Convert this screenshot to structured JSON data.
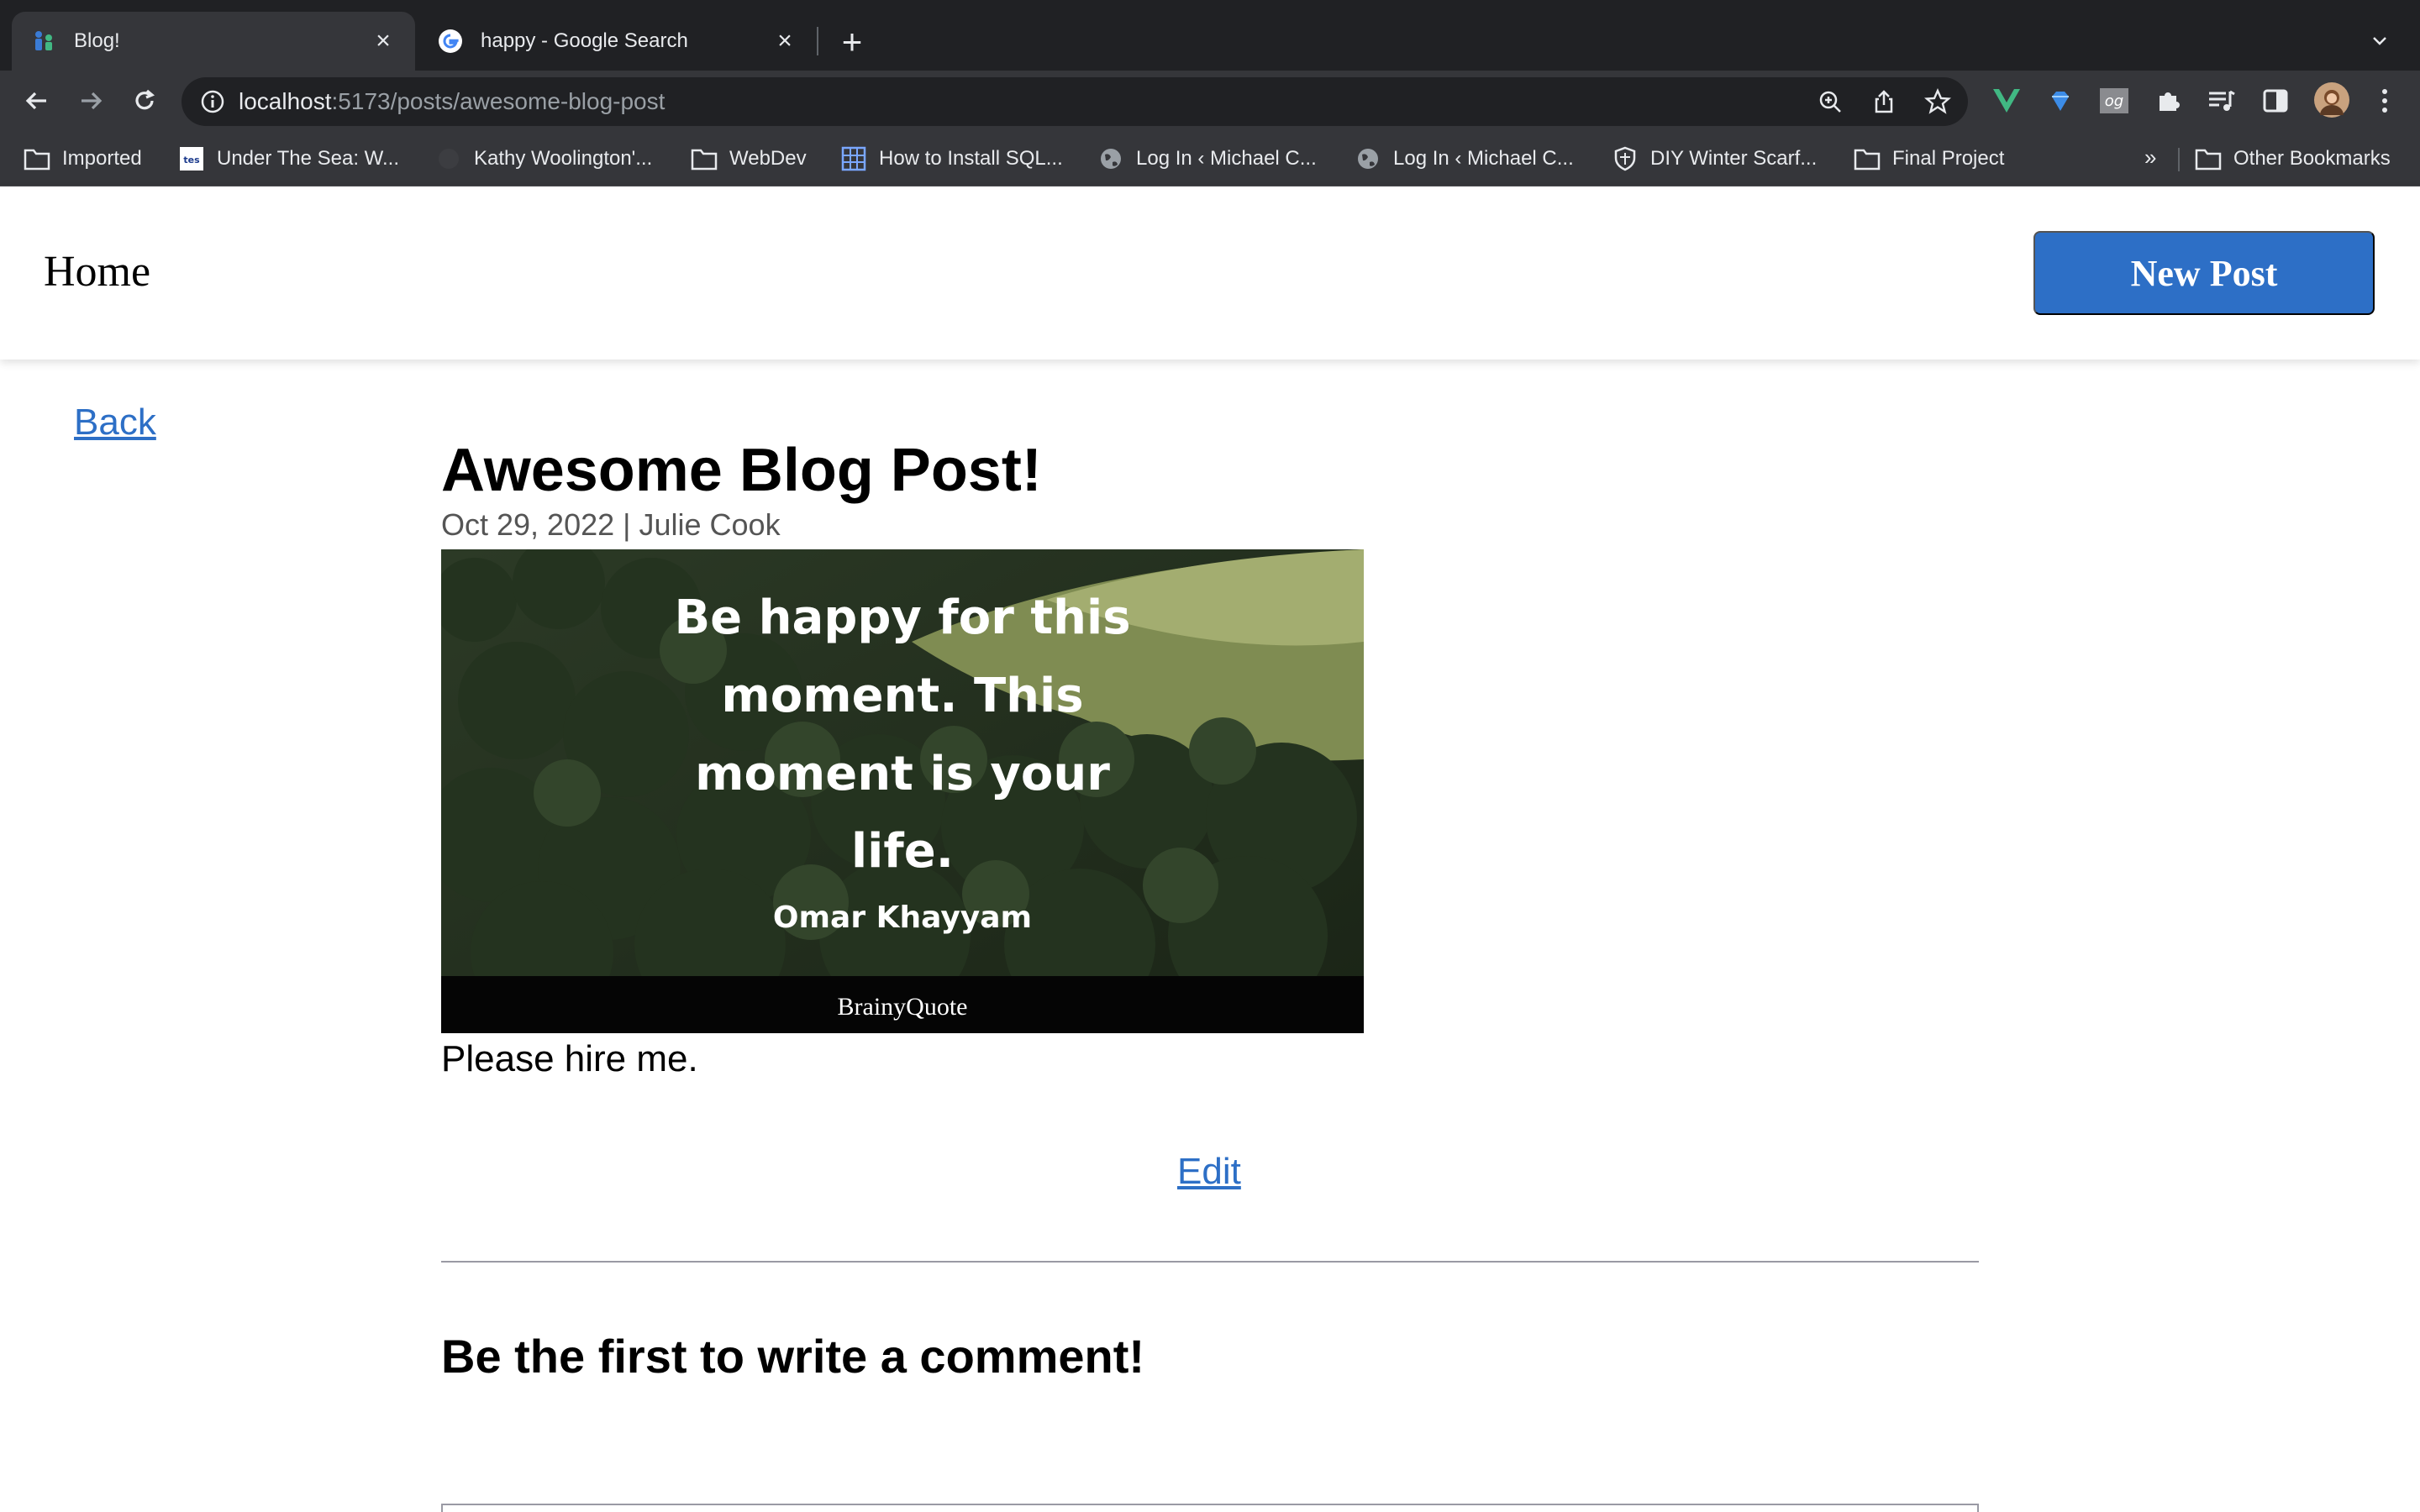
{
  "browser": {
    "tabs": [
      {
        "title": "Blog!",
        "icon": "blog-favicon",
        "active": true
      },
      {
        "title": "happy - Google Search",
        "icon": "google-favicon",
        "active": false
      }
    ],
    "address_bar": {
      "host": "localhost",
      "path": ":5173/posts/awesome-blog-post"
    },
    "extensions": [
      "vue-devtools-icon",
      "gem-icon",
      "og-icon",
      "puzzle-extension-icon",
      "reading-list-icon",
      "sidebar-icon",
      "profile-avatar"
    ],
    "bookmarks": [
      {
        "label": "Imported",
        "icon": "folder-icon"
      },
      {
        "label": "Under The Sea: W...",
        "icon": "tes-icon"
      },
      {
        "label": "Kathy Woolington'...",
        "icon": "blank-icon"
      },
      {
        "label": "WebDev",
        "icon": "folder-icon"
      },
      {
        "label": "How to Install SQL...",
        "icon": "grid-icon"
      },
      {
        "label": "Log In ‹ Michael C...",
        "icon": "globe-icon"
      },
      {
        "label": "Log In ‹ Michael C...",
        "icon": "globe-icon"
      },
      {
        "label": "DIY Winter Scarf...",
        "icon": "shield-icon"
      },
      {
        "label": "Final Project",
        "icon": "folder-icon"
      }
    ],
    "bookmarks_overflow": "»",
    "other_bookmarks": "Other Bookmarks"
  },
  "header": {
    "home_label": "Home",
    "new_post_label": "New Post",
    "accent_color": "#2d6fc6"
  },
  "post": {
    "back_label": "Back",
    "title": "Awesome Blog Post!",
    "meta": "Oct 29, 2022 | Julie Cook",
    "image": {
      "quote_lines": [
        "Be happy for this",
        "moment. This",
        "moment is your",
        "life."
      ],
      "author": "Omar Khayyam",
      "watermark": "BrainyQuote"
    },
    "body": "Please hire me.",
    "edit_label": "Edit"
  },
  "comments": {
    "heading": "Be the first to write a comment!"
  }
}
